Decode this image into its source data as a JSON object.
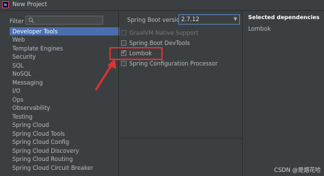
{
  "window": {
    "title": "New Project"
  },
  "filter": {
    "label": "Filter",
    "value": "",
    "placeholder": ""
  },
  "categories": {
    "items": [
      "Developer Tools",
      "Web",
      "Template Engines",
      "Security",
      "SQL",
      "NoSQL",
      "Messaging",
      "I/O",
      "Ops",
      "Observability",
      "Testing",
      "Spring Cloud",
      "Spring Cloud Tools",
      "Spring Cloud Config",
      "Spring Cloud Discovery",
      "Spring Cloud Routing",
      "Spring Cloud Circuit Breaker"
    ],
    "selected": "Developer Tools"
  },
  "spring_boot": {
    "label": "Spring Boot version",
    "value": "2.7.12"
  },
  "dependencies": [
    {
      "label": "GraalVM Native Support",
      "checked": false,
      "enabled": false
    },
    {
      "label": "Spring Boot DevTools",
      "checked": false,
      "enabled": true
    },
    {
      "label": "Lombok",
      "checked": true,
      "enabled": true
    },
    {
      "label": "Spring Configuration Processor",
      "checked": false,
      "enabled": true
    }
  ],
  "selected_dependencies": {
    "title": "Selected dependencies",
    "items": [
      "Lombok"
    ]
  },
  "watermark": "CSDN @是烟花哈",
  "colors": {
    "background": "#3c3f41",
    "selection": "#4b6eaf",
    "annotation": "#e03232",
    "focus_border": "#5a8ac6"
  }
}
